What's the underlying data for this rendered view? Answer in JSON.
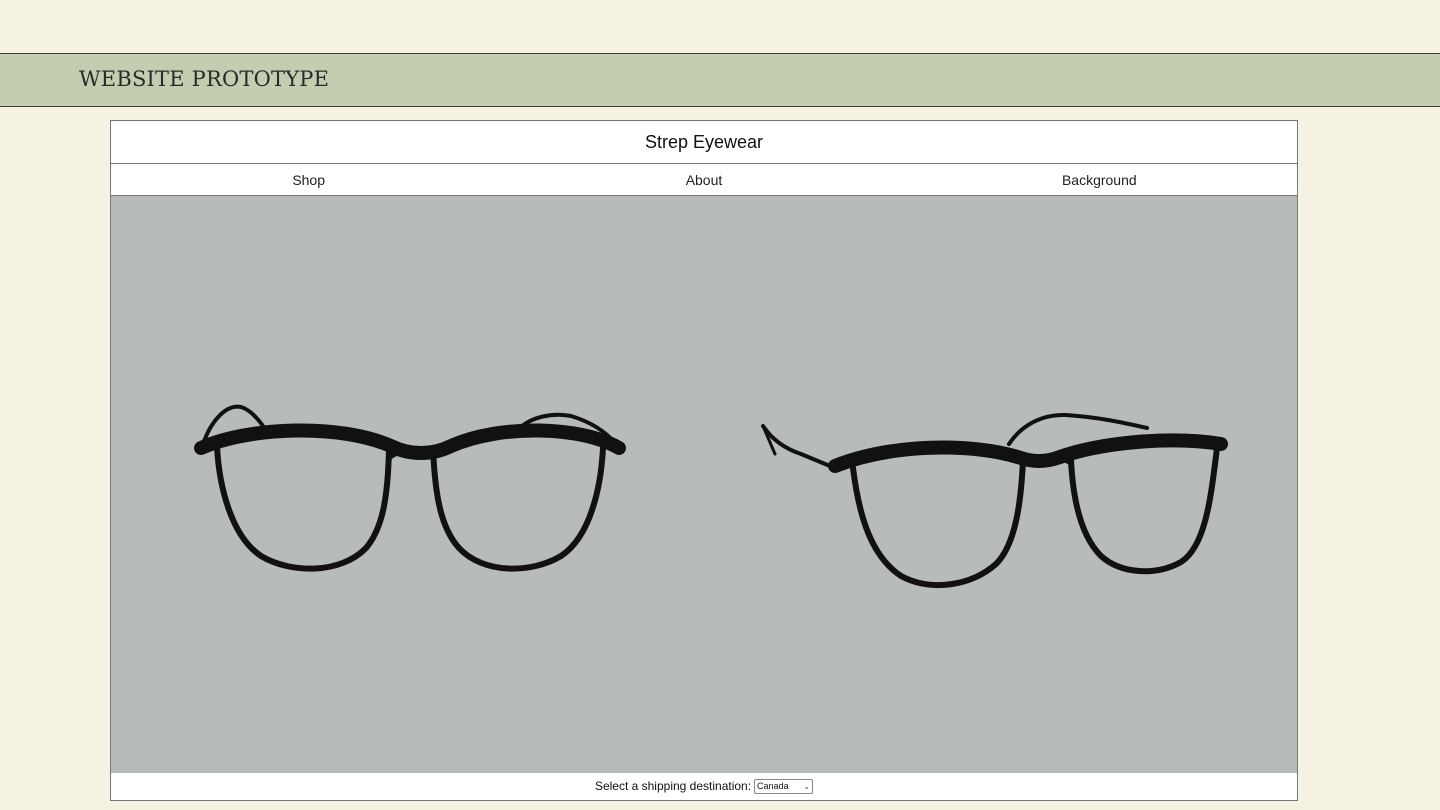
{
  "banner": {
    "title": "WEBSITE PROTOTYPE"
  },
  "site": {
    "title": "Strep Eyewear",
    "nav": [
      {
        "label": "Shop"
      },
      {
        "label": "About"
      },
      {
        "label": "Background"
      }
    ],
    "hero": {
      "images": [
        {
          "icon": "glasses-front-icon"
        },
        {
          "icon": "glasses-angled-icon"
        }
      ],
      "background_color": "#b7bcb8"
    },
    "footer": {
      "shipping_label": "Select a shipping destination:",
      "shipping_value": "Canada"
    }
  },
  "colors": {
    "page_background": "#f5f2e2",
    "banner_background": "#c3cdb0",
    "frame_color": "#111111"
  }
}
